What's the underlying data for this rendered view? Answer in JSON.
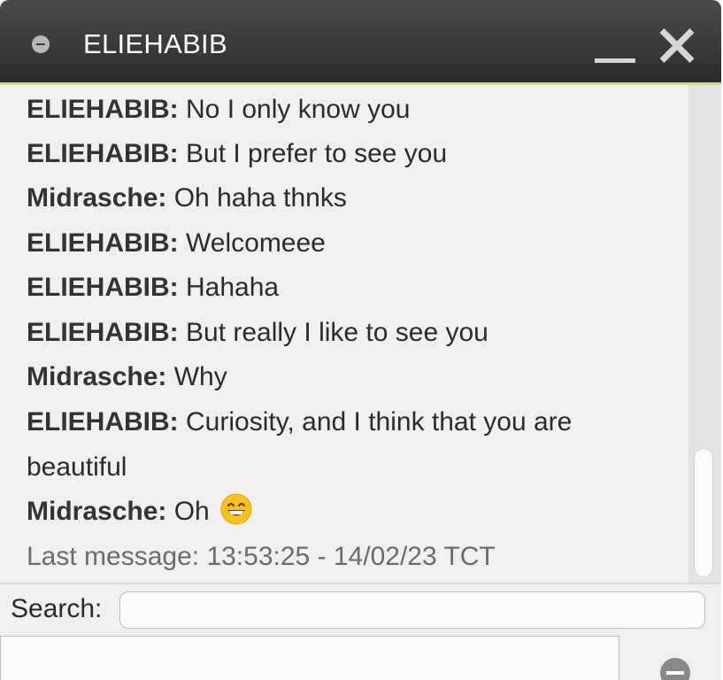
{
  "window": {
    "title": "ELIEHABIB"
  },
  "messages": [
    {
      "sender": "ELIEHABIB:",
      "text": " No I only know you"
    },
    {
      "sender": "ELIEHABIB:",
      "text": " But I prefer to see you"
    },
    {
      "sender": "Midrasche:",
      "text": " Oh haha thnks"
    },
    {
      "sender": "ELIEHABIB:",
      "text": " Welcomeee"
    },
    {
      "sender": "ELIEHABIB:",
      "text": " Hahaha"
    },
    {
      "sender": "ELIEHABIB:",
      "text": " But really I like to see you"
    },
    {
      "sender": "Midrasche:",
      "text": " Why"
    },
    {
      "sender": "ELIEHABIB:",
      "text": " Curiosity, and I think that you are beautiful"
    },
    {
      "sender": "Midrasche:",
      "text": " Oh",
      "emoji": "grinning-face-emoji"
    }
  ],
  "last_message": "Last message: 13:53:25 - 14/02/23 TCT",
  "search": {
    "label": "Search:",
    "value": ""
  },
  "icons": {
    "status": "status-dot-icon",
    "minimize": "minimize-icon",
    "close": "close-icon",
    "remove": "minus-circle-icon"
  },
  "colors": {
    "titlebar": "#3a3a3a",
    "accent": "#c7db8f",
    "background": "#f0f0f0"
  }
}
